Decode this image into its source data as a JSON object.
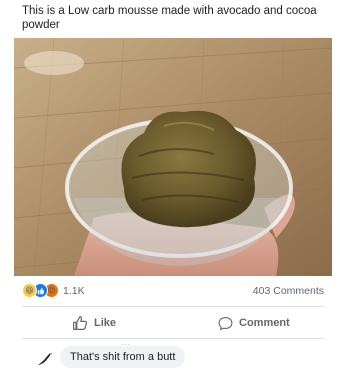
{
  "post": {
    "text": "This is a Low carb mousse made with avocado and cocoa powder",
    "photo_icon": "mousse-bowl-photo"
  },
  "reactions": {
    "icons": [
      "haha-reaction-icon",
      "like-reaction-icon",
      "angry-reaction-icon"
    ],
    "count": "1.1K",
    "comments_count": "403 Comments"
  },
  "actions": {
    "like_label": "Like",
    "like_icon": "thumbs-up-icon",
    "comment_label": "Comment",
    "comment_icon": "speech-bubble-icon"
  },
  "comment": {
    "text": "That's shit from a butt",
    "author_hint": "...",
    "avatar_icon": "bird-avatar-icon"
  },
  "colors": {
    "text": "#1c1e21",
    "muted": "#65676b",
    "like_blue": "#1877f2",
    "bubble_bg": "#f0f2f5"
  }
}
